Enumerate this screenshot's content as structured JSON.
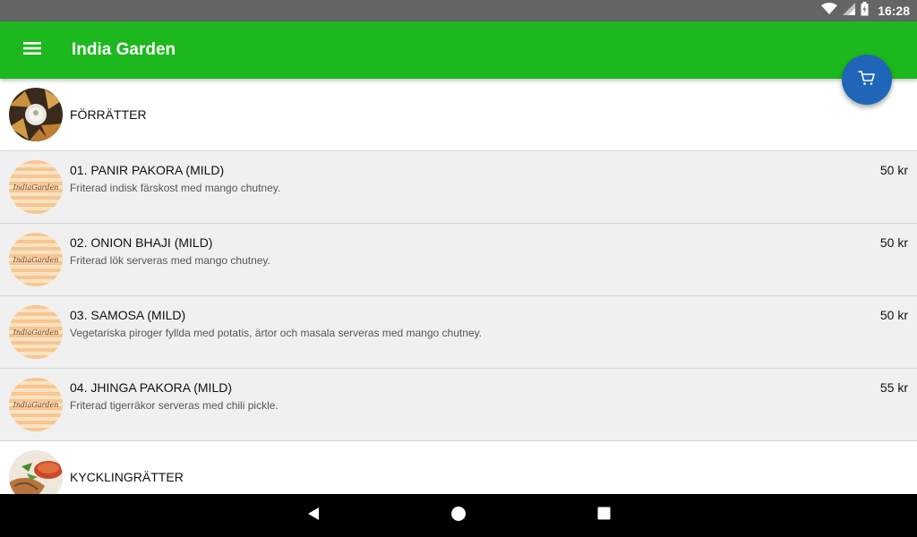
{
  "status_bar": {
    "time": "16:28",
    "icons": [
      "wifi-icon",
      "signal-icon",
      "battery-icon"
    ]
  },
  "app_bar": {
    "title": "India Garden",
    "menu_icon": "menu-icon",
    "background": "#1db81d"
  },
  "fab": {
    "icon": "cart-icon",
    "color": "#1f66b8"
  },
  "menu": {
    "categories": [
      {
        "label": "FÖRRÄTTER",
        "items": [
          {
            "name": "01. PANIR PAKORA (MILD)",
            "description": "Friterad indisk färskost med mango chutney.",
            "price": "50 kr",
            "logo": "IndiaGarden"
          },
          {
            "name": "02. ONION BHAJI (MILD)",
            "description": "Friterad lök serveras med mango chutney.",
            "price": "50 kr",
            "logo": "IndiaGarden"
          },
          {
            "name": "03. SAMOSA (MILD)",
            "description": "Vegetariska piroger fyllda med potatis, ärtor och masala serveras med mango chutney.",
            "price": "50 kr",
            "logo": "IndiaGarden"
          },
          {
            "name": "04. JHINGA PAKORA (MILD)",
            "description": "Friterad tigerräkor serveras med chili pickle.",
            "price": "55 kr",
            "logo": "IndiaGarden"
          }
        ]
      },
      {
        "label": "KYCKLINGRÄTTER",
        "items": []
      }
    ]
  },
  "nav_bar": {
    "back_icon": "back-icon",
    "home_icon": "home-icon",
    "recents_icon": "recents-icon"
  }
}
